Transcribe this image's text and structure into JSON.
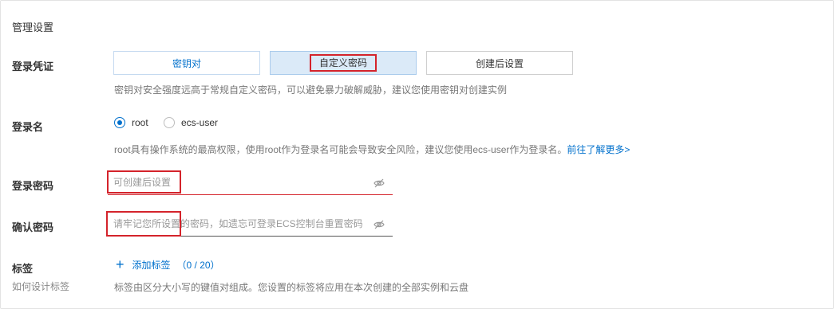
{
  "section": {
    "title": "管理设置"
  },
  "credential": {
    "label": "登录凭证",
    "options": [
      "密钥对",
      "自定义密码",
      "创建后设置"
    ],
    "selected": "自定义密码",
    "hint": "密钥对安全强度远高于常规自定义密码，可以避免暴力破解威胁，建议您使用密钥对创建实例"
  },
  "login_name": {
    "label": "登录名",
    "options": [
      "root",
      "ecs-user"
    ],
    "selected": "root",
    "hint": "root具有操作系统的最高权限，使用root作为登录名可能会导致安全风险，建议您使用ecs-user作为登录名。",
    "link": "前往了解更多>"
  },
  "password": {
    "label": "登录密码",
    "placeholder": "可创建后设置",
    "value": ""
  },
  "confirm_password": {
    "label": "确认密码",
    "placeholder": "请牢记您所设置的密码，如遗忘可登录ECS控制台重置密码",
    "value": ""
  },
  "tags": {
    "label": "标签",
    "sublabel": "如何设计标签",
    "add_label": "添加标签",
    "count": "（0 / 20）",
    "hint": "标签由区分大小写的键值对组成。您设置的标签将应用在本次创建的全部实例和云盘"
  },
  "icons": [
    "eye-off-icon",
    "plus-icon"
  ],
  "colors": {
    "accent": "#0070cc",
    "selected_bg": "#dbeaf8",
    "error_underline": "#d4232b",
    "highlight_box": "#d4232b"
  }
}
